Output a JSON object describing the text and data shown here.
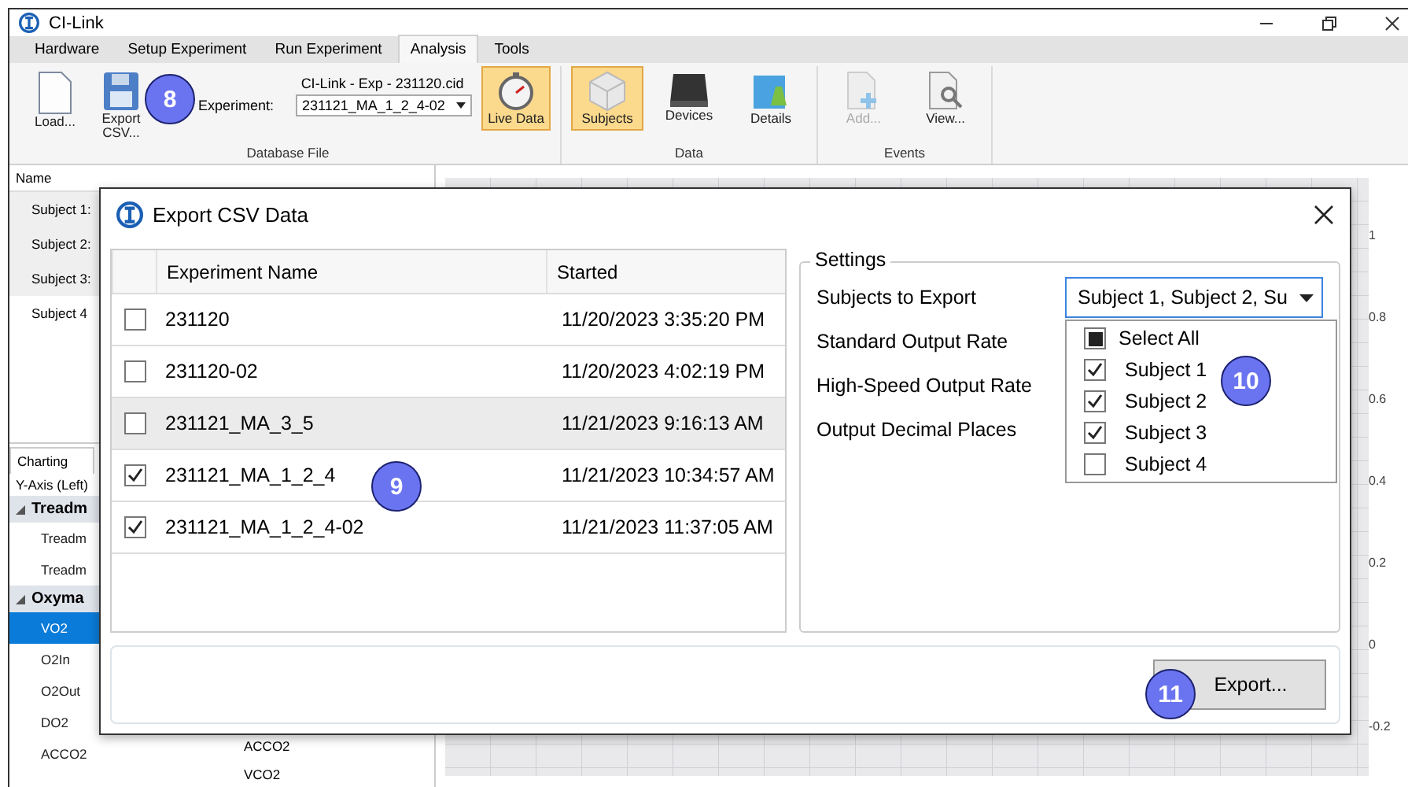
{
  "window": {
    "title": "CI-Link"
  },
  "ribbon_tabs": [
    {
      "label": "Hardware",
      "selected": false
    },
    {
      "label": "Setup Experiment",
      "selected": false
    },
    {
      "label": "Run Experiment",
      "selected": false
    },
    {
      "label": "Analysis",
      "selected": true
    },
    {
      "label": "Tools",
      "selected": false
    }
  ],
  "ribbon": {
    "database_file": {
      "label": "Database File",
      "load": "Load...",
      "export": "Export CSV...",
      "experiment_label": "Experiment:",
      "file_name": "CI-Link - Exp - 231120.cid",
      "experiment_value": "231121_MA_1_2_4-02",
      "live_data": {
        "label": "Live Data",
        "selected": true
      }
    },
    "data": {
      "label": "Data",
      "buttons": [
        {
          "label": "Subjects",
          "kind": "cube",
          "selected": true
        },
        {
          "label": "Devices",
          "kind": "device",
          "selected": false
        },
        {
          "label": "Details",
          "kind": "flask",
          "selected": false
        }
      ]
    },
    "events": {
      "label": "Events",
      "buttons": [
        {
          "label": "Add...",
          "kind": "add",
          "disabled": true
        },
        {
          "label": "View...",
          "kind": "view",
          "disabled": false
        }
      ]
    }
  },
  "subjects_panel": {
    "header": "Name",
    "items": [
      {
        "label": "Subject 1:",
        "selected": true
      },
      {
        "label": "Subject 2:",
        "selected": true
      },
      {
        "label": "Subject 3:",
        "selected": true
      },
      {
        "label": "Subject 4",
        "selected": false
      }
    ]
  },
  "charting": {
    "tab": "Charting",
    "group_label": "Y-Axis (Left)",
    "tree": [
      {
        "label": "Treadm",
        "expanded": true,
        "children": [
          {
            "label": "Treadm",
            "selected": false
          },
          {
            "label": "Treadm",
            "selected": false
          }
        ]
      },
      {
        "label": "Oxyma",
        "expanded": true,
        "children": [
          {
            "label": "VO2",
            "selected": true
          },
          {
            "label": "O2In",
            "selected": false
          },
          {
            "label": "O2Out",
            "selected": false
          },
          {
            "label": "DO2",
            "selected": false
          },
          {
            "label": "ACCO2",
            "selected": false
          }
        ]
      }
    ],
    "second_list": [
      "ACCO2",
      "VCO2"
    ]
  },
  "chart": {
    "y_tick_labels": [
      "1",
      "0.8",
      "0.6",
      "0.4",
      "0.2",
      "0",
      "-0.2"
    ]
  },
  "dialog": {
    "title": "Export CSV Data",
    "table": {
      "columns": [
        "Experiment Name",
        "Started"
      ],
      "rows": [
        {
          "name": "231120",
          "started": "11/20/2023 3:35:20 PM",
          "checked": false,
          "selected": false
        },
        {
          "name": "231120-02",
          "started": "11/20/2023 4:02:19 PM",
          "checked": false,
          "selected": false
        },
        {
          "name": "231121_MA_3_5",
          "started": "11/21/2023 9:16:13 AM",
          "checked": false,
          "selected": true
        },
        {
          "name": "231121_MA_1_2_4",
          "started": "11/21/2023 10:34:57 AM",
          "checked": true,
          "selected": false
        },
        {
          "name": "231121_MA_1_2_4-02",
          "started": "11/21/2023 11:37:05 AM",
          "checked": true,
          "selected": false
        }
      ]
    },
    "settings": {
      "label": "Settings",
      "fields": [
        "Subjects to Export",
        "Standard Output Rate",
        "High-Speed Output Rate",
        "Output Decimal Places"
      ],
      "subjects_value": "Subject 1, Subject 2, Su",
      "dropdown": {
        "expanded": true,
        "select_all": {
          "label": "Select All",
          "partial": true
        },
        "options": [
          {
            "label": "Subject 1",
            "checked": true
          },
          {
            "label": "Subject 2",
            "checked": true
          },
          {
            "label": "Subject 3",
            "checked": true
          },
          {
            "label": "Subject 4",
            "checked": false
          }
        ]
      }
    },
    "export_button": "Export..."
  },
  "callouts": [
    {
      "label": "8"
    },
    {
      "label": "9"
    },
    {
      "label": "10"
    },
    {
      "label": "11"
    }
  ]
}
